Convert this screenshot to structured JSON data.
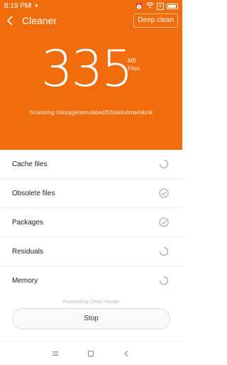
{
  "status_bar": {
    "time": "8:19 PM",
    "icons": [
      "alert-icon",
      "notification-icon",
      "signal-icon",
      "alarm-icon",
      "wifi-icon",
      "x-icon",
      "battery-icon"
    ]
  },
  "header": {
    "title": "Cleaner",
    "deep_clean_label": "Deep clean"
  },
  "scan": {
    "size_value": "335",
    "unit": "MB",
    "unit_label": "Files",
    "scanning_text": "Scanning /storage/emulated/0/baidu/ime/skink"
  },
  "items": [
    {
      "label": "Cache files",
      "state": "loading"
    },
    {
      "label": "Obsolete files",
      "state": "done"
    },
    {
      "label": "Packages",
      "state": "done"
    },
    {
      "label": "Residuals",
      "state": "loading"
    },
    {
      "label": "Memory",
      "state": "loading"
    }
  ],
  "footer": {
    "powered_by": "Powered by Clean Master",
    "stop_label": "Stop"
  },
  "colors": {
    "accent": "#f06c0c",
    "row_text": "#222222"
  }
}
